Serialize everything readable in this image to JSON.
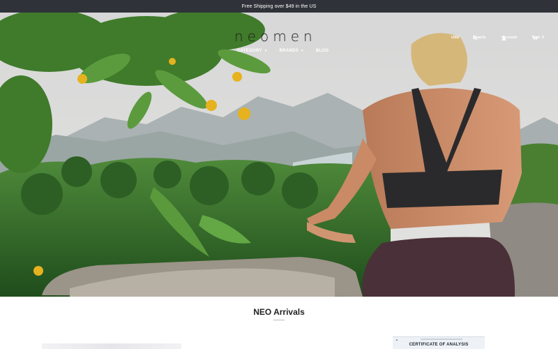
{
  "announcement": {
    "text": "Free Shipping over $49 in the US"
  },
  "brand": {
    "logo_text": "neomen"
  },
  "nav": {
    "items": [
      {
        "label": "CATEGORY"
      },
      {
        "label": "BRANDS"
      },
      {
        "label": "BLOG"
      }
    ]
  },
  "utility": {
    "currency": "USD",
    "search": "Search",
    "account": "Account",
    "cart": "Cart",
    "cart_count": "0"
  },
  "sections": {
    "arrivals_title": "NEO Arrivals",
    "certificate_title": "CERTIFICATE OF ANALYSIS"
  },
  "icons": {
    "search": "search-icon",
    "account": "account-icon",
    "cart": "cart-icon",
    "chevron": "chevron-down-icon"
  }
}
